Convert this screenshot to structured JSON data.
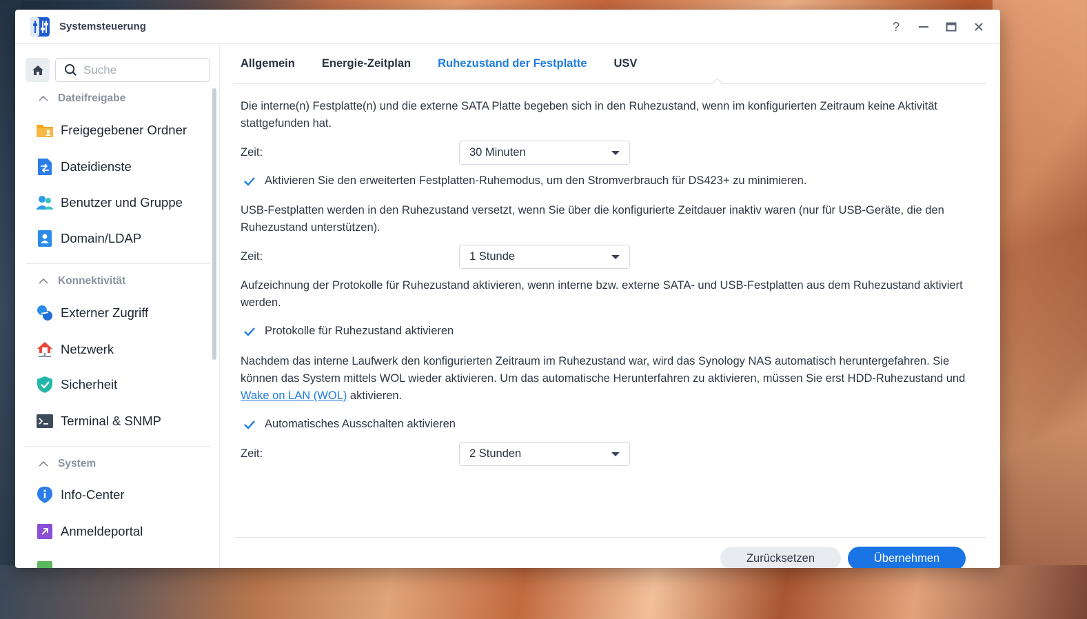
{
  "window": {
    "title": "Systemsteuerung",
    "controls": {
      "help": "?",
      "minimize": "—",
      "maximize": "▭",
      "close": "✕"
    }
  },
  "sidebar": {
    "search_placeholder": "Suche",
    "sections": [
      {
        "title": "Dateifreigabe",
        "items": [
          "Freigegebener Ordner",
          "Dateidienste",
          "Benutzer und Gruppe",
          "Domain/LDAP"
        ]
      },
      {
        "title": "Konnektivität",
        "items": [
          "Externer Zugriff",
          "Netzwerk",
          "Sicherheit",
          "Terminal & SNMP"
        ]
      },
      {
        "title": "System",
        "items": [
          "Info-Center",
          "Anmeldeportal"
        ]
      }
    ]
  },
  "tabs": [
    "Allgemein",
    "Energie-Zeitplan",
    "Ruhezustand der Festplatte",
    "USV"
  ],
  "active_tab": "Ruhezustand der Festplatte",
  "content": {
    "intro": "Die interne(n) Festplatte(n) und die externe SATA Platte begeben sich in den Ruhezustand, wenn im konfigurierten Zeitraum keine Aktivität stattgefunden hat.",
    "time_label": "Zeit:",
    "time1_value": "30 Minuten",
    "advanced_check_label": "Aktivieren Sie den erweiterten Festplatten-Ruhemodus, um den Stromverbrauch für DS423+ zu minimieren.",
    "usb_text": "USB-Festplatten werden in den Ruhezustand versetzt, wenn Sie über die konfigurierte Zeitdauer inaktiv waren (nur für USB-Geräte, die den Ruhezustand unterstützen).",
    "time2_value": "1 Stunde",
    "log_text": "Aufzeichnung der Protokolle für Ruhezustand aktivieren, wenn interne bzw. externe SATA- und USB-Festplatten aus dem Ruhezustand aktiviert werden.",
    "log_check_label": "Protokolle für Ruhezustand aktivieren",
    "shutdown_text_before": "Nachdem das interne Laufwerk den konfigurierten Zeitraum im Ruhezustand war, wird das Synology NAS automatisch heruntergefahren. Sie können das System mittels WOL wieder aktivieren. Um das automatische Herunterfahren zu aktivieren, müssen Sie erst HDD-Ruhezustand und ",
    "shutdown_link": "Wake on LAN (WOL)",
    "shutdown_text_after": " aktivieren.",
    "shutdown_check_label": "Automatisches Ausschalten aktivieren",
    "time3_value": "2 Stunden"
  },
  "buttons": {
    "reset": "Zurücksetzen",
    "apply": "Übernehmen"
  },
  "colors": {
    "accent": "#1a74e4",
    "active_tab": "#1f7ce0",
    "text": "#2f3744"
  }
}
